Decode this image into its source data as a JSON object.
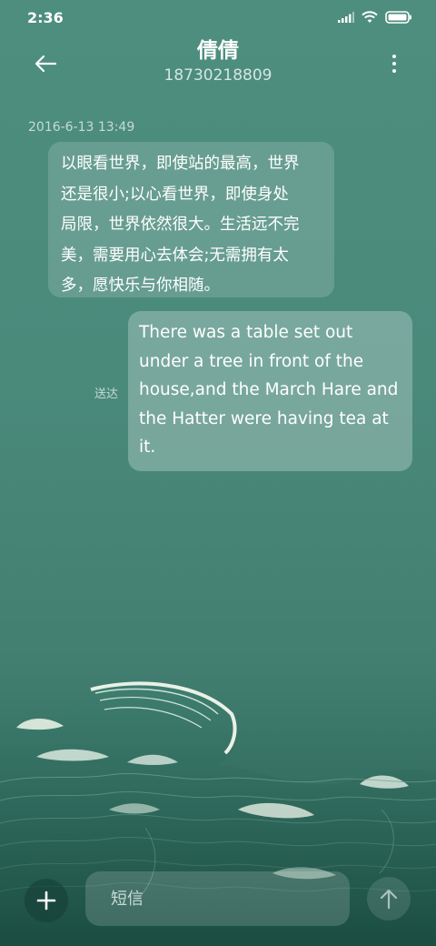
{
  "status_bar": {
    "time": "2:36",
    "icons": [
      "signal-icon",
      "wifi-icon",
      "battery-icon"
    ]
  },
  "header": {
    "contact_name": "倩倩",
    "contact_number": "18730218809",
    "back_icon": "arrow-left-icon",
    "more_icon": "more-vertical-icon"
  },
  "conversation": {
    "timestamp": "2016-6-13 13:49",
    "messages": [
      {
        "direction": "incoming",
        "lines": [
          "以眼看世界，即使站的最高，世界",
          "还是很小;以心看世界，即使身处",
          "局限，世界依然很大。生活远不完",
          "美，需要用心去体会;无需拥有太",
          "多，愿快乐与你相随。"
        ]
      },
      {
        "direction": "outgoing",
        "lines": [
          "There was a table set out",
          "under a tree in front of the",
          "house,and the March Hare and",
          "the Hatter were having tea at",
          "it."
        ],
        "status": "送达"
      }
    ]
  },
  "input_bar": {
    "placeholder": "短信",
    "add_icon": "plus-icon",
    "send_icon": "arrow-up-icon"
  },
  "colors": {
    "background_top": "#4e8e7e",
    "background_bottom": "#1f5348",
    "bubble_incoming": "rgba(255,255,255,0.16)",
    "bubble_outgoing": "rgba(255,255,255,0.26)",
    "muted_text": "#c4dbd4"
  }
}
